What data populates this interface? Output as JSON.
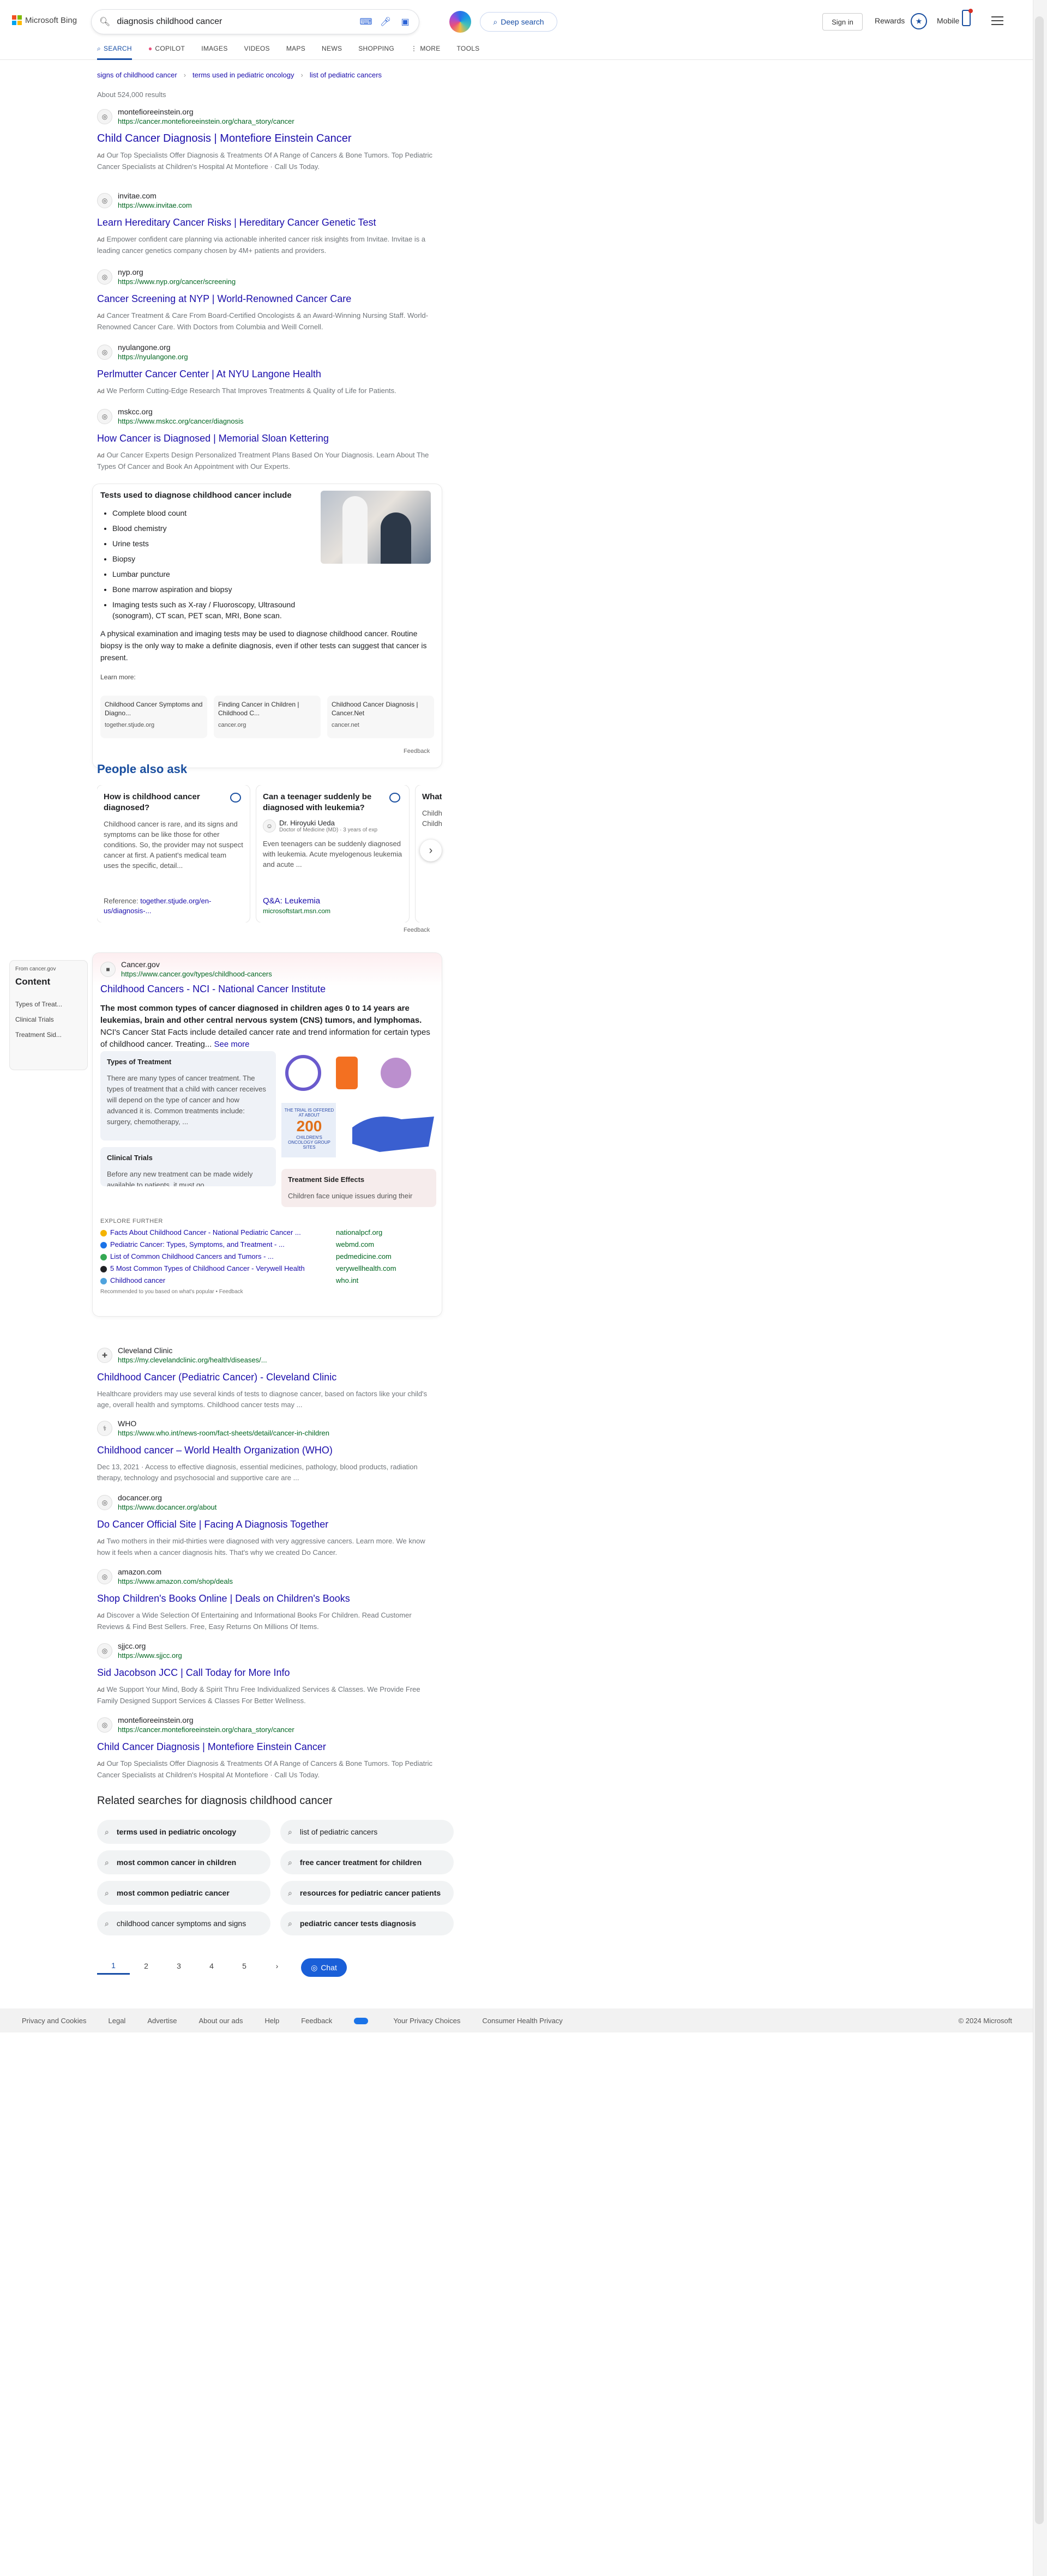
{
  "header": {
    "logo_text": "Microsoft Bing",
    "query": "diagnosis childhood cancer",
    "deep_search": "Deep search",
    "sign_in": "Sign in",
    "rewards": "Rewards",
    "mobile": "Mobile",
    "tabs": [
      "SEARCH",
      "COPILOT",
      "IMAGES",
      "VIDEOS",
      "MAPS",
      "NEWS",
      "SHOPPING",
      "MORE",
      "TOOLS"
    ],
    "active_tab": "SEARCH",
    "colors": {
      "accent": "#174ea6",
      "link": "#1a0dab",
      "url": "#006621"
    }
  },
  "related_chips": [
    "signs of childhood cancer",
    "terms used in pediatric oncology",
    "list of pediatric cancers"
  ],
  "result_count": "About 524,000 results",
  "results_top": [
    {
      "site": "montefioreeinstein.org",
      "url": "https://cancer.montefioreeinstein.org/chara_story/cancer",
      "title": "Child Cancer Diagnosis | Montefiore Einstein Cancer",
      "snippet": "Our Top Specialists Offer Diagnosis & Treatments Of A Range of Cancers & Bone Tumors. Top Pediatric Cancer Specialists at Children's Hospital At Montefiore · Call Us Today."
    },
    {
      "site": "invitae.com",
      "url": "https://www.invitae.com",
      "title": "Learn Hereditary Cancer Risks | Hereditary Cancer Genetic Test",
      "snippet": "Empower confident care planning via actionable inherited cancer risk insights from Invitae. Invitae is a leading cancer genetics company chosen by 4M+ patients and providers."
    },
    {
      "site": "nyp.org",
      "url": "https://www.nyp.org/cancer/screening",
      "title": "Cancer Screening at NYP | World-Renowned Cancer Care",
      "snippet": "Cancer Treatment & Care From Board-Certified Oncologists & an Award-Winning Nursing Staff. World-Renowned Cancer Care. With Doctors from Columbia and Weill Cornell."
    },
    {
      "site": "nyulangone.org",
      "url": "https://nyulangone.org",
      "title": "Perlmutter Cancer Center | At NYU Langone Health",
      "snippet": "We Perform Cutting-Edge Research That Improves Treatments & Quality of Life for Patients."
    },
    {
      "site": "mskcc.org",
      "url": "https://www.mskcc.org/cancer/diagnosis",
      "title": "How Cancer is Diagnosed | Memorial Sloan Kettering",
      "snippet": "Our Cancer Experts Design Personalized Treatment Plans Based On Your Diagnosis. Learn About The Types Of Cancer and Book An Appointment with Our Experts."
    }
  ],
  "ad_tag": "Ad",
  "answer": {
    "heading": "Tests used to diagnose childhood cancer include",
    "items": [
      "Complete blood count",
      "Blood chemistry",
      "Urine tests",
      "Biopsy",
      "Lumbar puncture",
      "Bone marrow aspiration and biopsy",
      "Imaging tests such as X-ray / Fluoroscopy, Ultrasound (sonogram), CT scan, PET scan, MRI, Bone scan."
    ],
    "paragraph": "A physical examination and imaging tests may be used to diagnose childhood cancer. Routine biopsy is the only way to make a definite diagnosis, even if other tests can suggest that cancer is present.",
    "learn_more": "Learn more:",
    "cards": [
      {
        "title": "Childhood Cancer Symptoms and Diagno...",
        "domain": "together.stjude.org"
      },
      {
        "title": "Finding Cancer in Children | Childhood C...",
        "domain": "cancer.org"
      },
      {
        "title": "Childhood Cancer Diagnosis | Cancer.Net",
        "domain": "cancer.net"
      }
    ],
    "feedback": "Feedback"
  },
  "paa": {
    "title": "People also ask",
    "cards": [
      {
        "q": "How is childhood cancer diagnosed?",
        "body": "Childhood cancer is rare, and its signs and symptoms can be like those for other conditions. So, the provider may not suspect cancer at first. A patient's medical team uses the specific, detail...",
        "ref_label": "Reference:",
        "ref": "together.stjude.org/en-us/diagnosis-..."
      },
      {
        "q": "Can a teenager suddenly be diagnosed with leukemia?",
        "author": "Dr. Hiroyuki Ueda",
        "author_sub": "Doctor of Medicine (MD) · 3 years of exp",
        "body": "Even teenagers can be suddenly diagnosed with leukemia. Acute myelogenous leukemia and acute ...",
        "ref": "Q&A: Leukemia",
        "ref_domain": "microsoftstart.msn.com"
      },
      {
        "q": "What i...",
        "body": "Childh... a group... childho... teens... Childh..."
      }
    ],
    "feedback": "Feedback"
  },
  "sidenav": {
    "from": "From cancer.gov",
    "title": "Content",
    "items": [
      "Types of Treat...",
      "Clinical Trials",
      "Treatment Sid..."
    ]
  },
  "gov": {
    "site": "Cancer.gov",
    "url": "https://www.cancer.gov/types/childhood-cancers",
    "title": "Childhood Cancers - NCI - National Cancer Institute",
    "lead_bold": "The most common types of cancer diagnosed in children ages 0 to 14 years are leukemias, brain and other central nervous system (CNS) tumors, and lymphomas.",
    "lead_rest": "NCI's Cancer Stat Facts include detailed cancer rate and trend information for certain types of childhood cancer. Treating...",
    "see_more": "See more",
    "treatment_title": "Types of Treatment",
    "treatment_body": "There are many types of cancer treatment. The types of treatment that a child with cancer receives will depend on the type of cancer and how advanced it is. Common treatments include: surgery, chemotherapy, ...",
    "trials_title": "Clinical Trials",
    "trials_body": "Before any new treatment can be made widely available to patients, it must go",
    "side_title": "Treatment Side Effects",
    "side_body": "Children face unique issues during their",
    "infographic_text": "THE TRIAL IS OFFERED AT ABOUT",
    "infographic_num": "200",
    "infographic_sub": "CHILDREN'S ONCOLOGY GROUP SITES",
    "explore_title": "EXPLORE FURTHER",
    "explore": [
      {
        "l": "Facts About Childhood Cancer - National Pediatric Cancer ...",
        "r": "nationalpcf.org",
        "c": "#f4b400"
      },
      {
        "l": "Pediatric Cancer: Types, Symptoms, and Treatment - ...",
        "r": "webmd.com",
        "c": "#1a73e8"
      },
      {
        "l": "List of Common Childhood Cancers and Tumors - ...",
        "r": "pedmedicine.com",
        "c": "#34a853"
      },
      {
        "l": "5 Most Common Types of Childhood Cancer - Verywell Health",
        "r": "verywellhealth.com",
        "c": "#202124"
      },
      {
        "l": "Childhood cancer",
        "r": "who.int",
        "c": "#4fa3dd"
      }
    ],
    "recommended": "Recommended to you based on what's popular • Feedback"
  },
  "results_bottom": [
    {
      "site": "Cleveland Clinic",
      "url": "https://my.clevelandclinic.org/health/diseases/...",
      "title": "Childhood Cancer (Pediatric Cancer) - Cleveland Clinic",
      "snippet": "Healthcare providers may use several kinds of tests to diagnose cancer, based on factors like your child's age, overall health and symptoms. Childhood cancer tests may ..."
    },
    {
      "site": "WHO",
      "url": "https://www.who.int/news-room/fact-sheets/detail/cancer-in-children",
      "title": "Childhood cancer – World Health Organization (WHO)",
      "snippet": "Dec 13, 2021 · Access to effective diagnosis, essential medicines, pathology, blood products, radiation therapy, technology and psychosocial and supportive care are ..."
    },
    {
      "site": "docancer.org",
      "url": "https://www.docancer.org/about",
      "title": "Do Cancer Official Site | Facing A Diagnosis Together",
      "snippet": "Two mothers in their mid-thirties were diagnosed with very aggressive cancers. Learn more. We know how it feels when a cancer diagnosis hits. That's why we created Do Cancer."
    },
    {
      "site": "amazon.com",
      "url": "https://www.amazon.com/shop/deals",
      "title": "Shop Children's Books Online | Deals on Children's Books",
      "snippet": "Discover a Wide Selection Of Entertaining and Informational Books For Children. Read Customer Reviews & Find Best Sellers. Free, Easy Returns On Millions Of Items."
    },
    {
      "site": "sjjcc.org",
      "url": "https://www.sjjcc.org",
      "title": "Sid Jacobson JCC | Call Today for More Info",
      "snippet": "We Support Your Mind, Body & Spirit Thru Free Individualized Services & Classes. We Provide Free Family Designed Support Services & Classes For Better Wellness."
    },
    {
      "site": "montefioreeinstein.org",
      "url": "https://cancer.montefioreeinstein.org/chara_story/cancer",
      "title": "Child Cancer Diagnosis | Montefiore Einstein Cancer",
      "snippet": "Our Top Specialists Offer Diagnosis & Treatments Of A Range of Cancers & Bone Tumors. Top Pediatric Cancer Specialists at Children's Hospital At Montefiore · Call Us Today."
    }
  ],
  "related": {
    "title": "Related searches for diagnosis childhood cancer",
    "items": [
      "terms used in pediatric oncology",
      "list of pediatric cancers",
      "most common cancer in children",
      "free cancer treatment for children",
      "most common pediatric cancer",
      "resources for pediatric cancer patients",
      "childhood cancer symptoms and signs",
      "pediatric cancer tests diagnosis"
    ]
  },
  "pager": {
    "pages": [
      "1",
      "2",
      "3",
      "4",
      "5"
    ],
    "active": "1",
    "chat": "Chat"
  },
  "footer": {
    "links": [
      "Privacy and Cookies",
      "Legal",
      "Advertise",
      "About our ads",
      "Help",
      "Feedback",
      "Your Privacy Choices",
      "Consumer Health Privacy"
    ],
    "copyright": "© 2024 Microsoft"
  }
}
